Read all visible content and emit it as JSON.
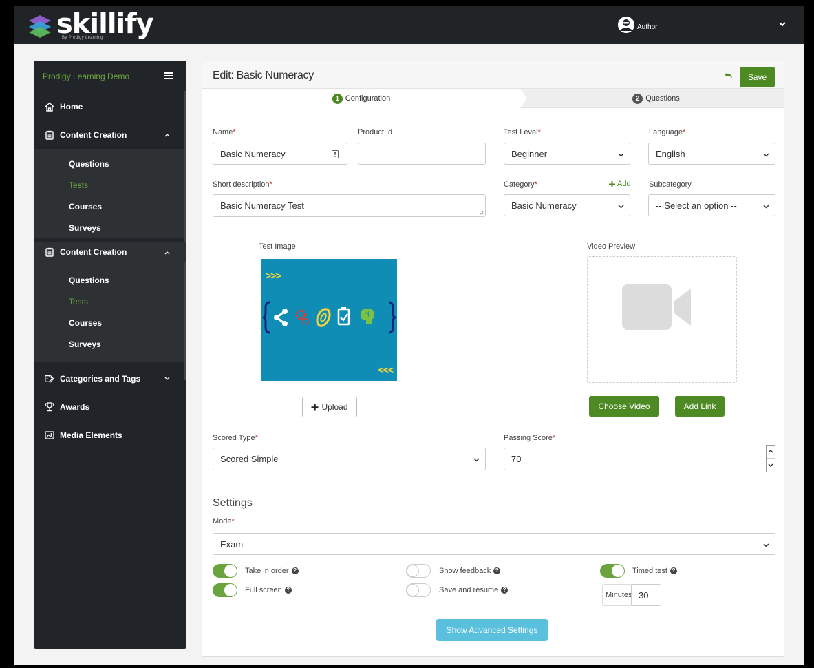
{
  "app": {
    "logo_text": "skillify",
    "logo_subtext": "By Prodigy Learning",
    "user_name": "Author",
    "accent_color": "#4e8a24",
    "sidebar_active_color": "#6ba33e"
  },
  "sidebar": {
    "org_name": "Prodigy Learning Demo",
    "home": "Home",
    "sections": [
      {
        "label": "Content Creation",
        "items": [
          "Questions",
          "Tests",
          "Courses",
          "Surveys"
        ],
        "active": "Tests"
      },
      {
        "label": "Content Creation",
        "items": [
          "Questions",
          "Tests",
          "Courses",
          "Surveys"
        ],
        "active": "Tests"
      }
    ],
    "categories_and_tags": "Categories and Tags",
    "awards": "Awards",
    "media_elements": "Media Elements"
  },
  "header": {
    "title": "Edit: Basic Numeracy",
    "save_label": "Save"
  },
  "steps": [
    {
      "number": "1",
      "label": "Configuration",
      "active": true
    },
    {
      "number": "2",
      "label": "Questions",
      "active": false
    }
  ],
  "form": {
    "name_label": "Name",
    "name_value": "Basic Numeracy",
    "product_id_label": "Product Id",
    "product_id_value": "",
    "test_level_label": "Test Level",
    "test_level_value": "Beginner",
    "language_label": "Language",
    "language_value": "English",
    "short_desc_label": "Short description",
    "short_desc_value": "Basic Numeracy Test",
    "category_label": "Category",
    "category_add": "Add",
    "category_value": "Basic Numeracy",
    "subcategory_label": "Subcategory",
    "subcategory_value": "-- Select an option --",
    "required_mark": "*"
  },
  "media": {
    "test_image_label": "Test Image",
    "upload_label": "Upload",
    "video_preview_label": "Video Preview",
    "choose_video_label": "Choose Video",
    "add_link_label": "Add Link",
    "image_top_chevrons": ">>>",
    "image_bottom_chevrons": "<<<"
  },
  "scoring": {
    "scored_type_label": "Scored Type",
    "scored_type_value": "Scored Simple",
    "passing_score_label": "Passing Score",
    "passing_score_value": "70"
  },
  "settings": {
    "heading": "Settings",
    "mode_label": "Mode",
    "mode_value": "Exam",
    "toggles": [
      {
        "label": "Take in order",
        "on": true
      },
      {
        "label": "Show feedback",
        "on": false
      },
      {
        "label": "Timed test",
        "on": true
      },
      {
        "label": "Full screen",
        "on": true
      },
      {
        "label": "Save and resume",
        "on": false
      }
    ],
    "minutes_label": "Minutes",
    "minutes_value": "30",
    "advanced_label": "Show Advanced Settings"
  }
}
